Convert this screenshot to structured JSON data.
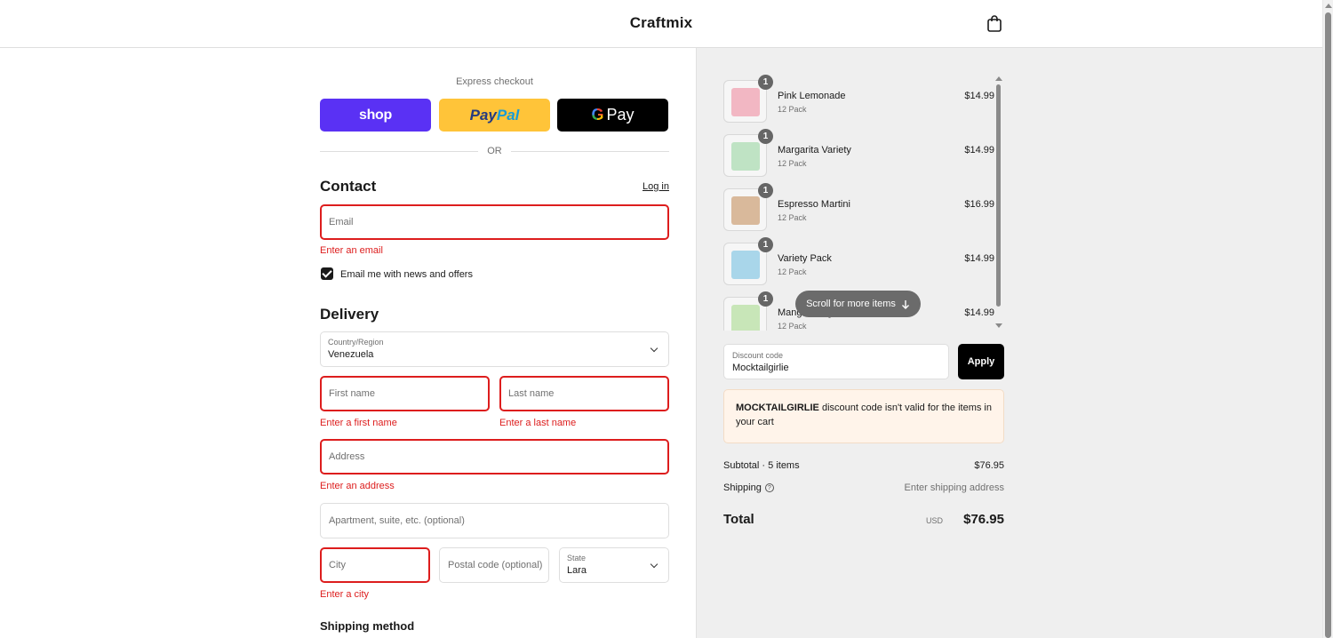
{
  "header": {
    "brand": "Craftmix",
    "cart_icon": "shopping-bag-icon"
  },
  "express": {
    "label": "Express checkout",
    "shop": "shop",
    "paypal_part1": "Pay",
    "paypal_part2": "Pal",
    "gpay_g": "G",
    "gpay_text": "Pay",
    "or": "OR"
  },
  "contact": {
    "title": "Contact",
    "login": "Log in",
    "email_placeholder": "Email",
    "email_error": "Enter an email",
    "newsletter_label": "Email me with news and offers",
    "newsletter_checked": true
  },
  "delivery": {
    "title": "Delivery",
    "country_label": "Country/Region",
    "country_value": "Venezuela",
    "first_name_placeholder": "First name",
    "first_name_error": "Enter a first name",
    "last_name_placeholder": "Last name",
    "last_name_error": "Enter a last name",
    "address_placeholder": "Address",
    "address_error": "Enter an address",
    "apartment_placeholder": "Apartment, suite, etc. (optional)",
    "city_placeholder": "City",
    "city_error": "Enter a city",
    "postal_placeholder": "Postal code (optional)",
    "state_label": "State",
    "state_value": "Lara"
  },
  "shipping_method": {
    "title": "Shipping method"
  },
  "cart": {
    "items": [
      {
        "name": "Pink Lemonade",
        "variant": "12 Pack",
        "price": "$14.99",
        "qty": "1",
        "color": "#f2b7c3"
      },
      {
        "name": "Margarita Variety",
        "variant": "12 Pack",
        "price": "$14.99",
        "qty": "1",
        "color": "#bfe3c4"
      },
      {
        "name": "Espresso Martini",
        "variant": "12 Pack",
        "price": "$16.99",
        "qty": "1",
        "color": "#d9b99b"
      },
      {
        "name": "Variety Pack",
        "variant": "12 Pack",
        "price": "$14.99",
        "qty": "1",
        "color": "#a9d6ea"
      },
      {
        "name": "Mango Margarita",
        "variant": "12 Pack",
        "price": "$14.99",
        "qty": "1",
        "color": "#c8e6b8"
      }
    ],
    "scroll_hint": "Scroll for more items",
    "discount_label": "Discount code",
    "discount_value": "Mocktailgirlie",
    "apply": "Apply",
    "notice_code": "MOCKTAILGIRLIE",
    "notice_text": " discount code isn't valid for the items in your cart",
    "subtotal_label": "Subtotal · 5 items",
    "subtotal_value": "$76.95",
    "shipping_label": "Shipping",
    "shipping_value": "Enter shipping address",
    "total_label": "Total",
    "total_currency": "USD",
    "total_value": "$76.95"
  }
}
